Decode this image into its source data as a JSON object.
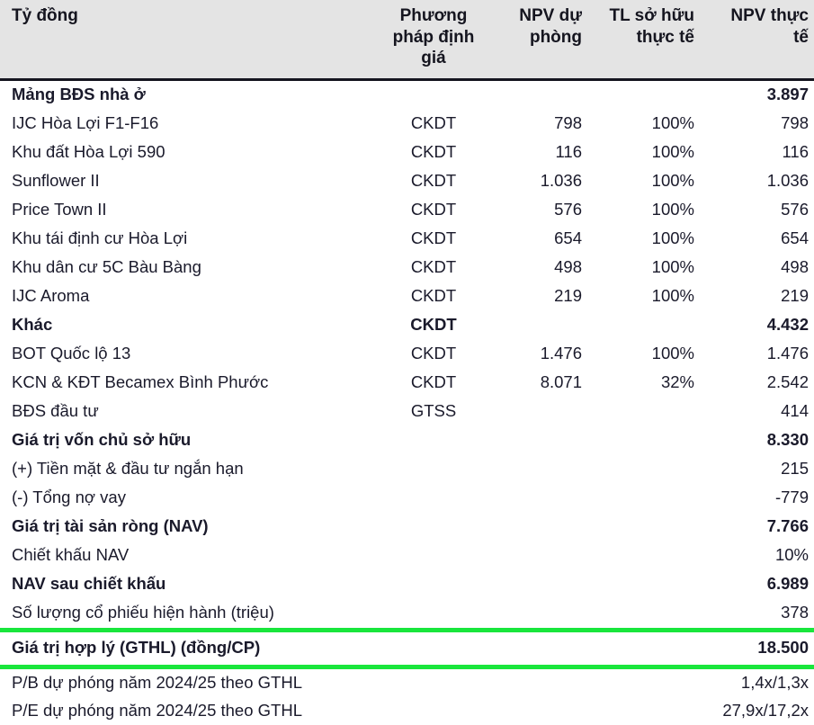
{
  "table": {
    "columns": [
      {
        "key": "label",
        "header": "Tỷ đồng",
        "align": "left"
      },
      {
        "key": "method",
        "header": "Phương pháp định giá",
        "align": "center"
      },
      {
        "key": "npv",
        "header": "NPV dự phòng",
        "align": "right"
      },
      {
        "key": "own",
        "header": "TL sở hữu thực tế",
        "align": "right"
      },
      {
        "key": "actual",
        "header": "NPV thực tế",
        "align": "right"
      }
    ],
    "header": {
      "label": "Tỷ đồng",
      "method_line1": "Phương",
      "method_line2": "pháp định",
      "method_line3": "giá",
      "npv_line1": "NPV dự",
      "npv_line2": "phòng",
      "own_line1": "TL sở hữu",
      "own_line2": "thực tế",
      "actual_line1": "NPV thực",
      "actual_line2": "tế"
    },
    "rows": [
      {
        "label": "Mảng BĐS nhà ở",
        "method": "",
        "npv": "",
        "own": "",
        "actual": "3.897",
        "style": "bold"
      },
      {
        "label": "IJC Hòa Lợi F1-F16",
        "method": "CKDT",
        "npv": "798",
        "own": "100%",
        "actual": "798",
        "style": "normal"
      },
      {
        "label": "Khu đất Hòa Lợi 590",
        "method": "CKDT",
        "npv": "116",
        "own": "100%",
        "actual": "116",
        "style": "normal"
      },
      {
        "label": "Sunflower II",
        "method": "CKDT",
        "npv": "1.036",
        "own": "100%",
        "actual": "1.036",
        "style": "normal"
      },
      {
        "label": "Price Town II",
        "method": "CKDT",
        "npv": "576",
        "own": "100%",
        "actual": "576",
        "style": "normal"
      },
      {
        "label": "Khu tái định cư Hòa Lợi",
        "method": "CKDT",
        "npv": "654",
        "own": "100%",
        "actual": "654",
        "style": "normal"
      },
      {
        "label": "Khu dân cư 5C Bàu Bàng",
        "method": "CKDT",
        "npv": "498",
        "own": "100%",
        "actual": "498",
        "style": "normal"
      },
      {
        "label": "IJC Aroma",
        "method": "CKDT",
        "npv": "219",
        "own": "100%",
        "actual": "219",
        "style": "normal"
      },
      {
        "label": "Khác",
        "method": "CKDT",
        "npv": "",
        "own": "",
        "actual": "4.432",
        "style": "bold"
      },
      {
        "label": "BOT Quốc lộ 13",
        "method": "CKDT",
        "npv": "1.476",
        "own": "100%",
        "actual": "1.476",
        "style": "normal"
      },
      {
        "label": "KCN & KĐT Becamex Bình Phước",
        "method": "CKDT",
        "npv": "8.071",
        "own": "32%",
        "actual": "2.542",
        "style": "normal"
      },
      {
        "label": "BĐS đầu tư",
        "method": "GTSS",
        "npv": "",
        "own": "",
        "actual": "414",
        "style": "normal"
      },
      {
        "label": "Giá trị vốn chủ sở hữu",
        "method": "",
        "npv": "",
        "own": "",
        "actual": "8.330",
        "style": "bold"
      },
      {
        "label": "(+) Tiền mặt & đầu tư ngắn hạn",
        "method": "",
        "npv": "",
        "own": "",
        "actual": "215",
        "style": "normal"
      },
      {
        "label": "(-) Tổng nợ vay",
        "method": "",
        "npv": "",
        "own": "",
        "actual": "-779",
        "style": "normal"
      },
      {
        "label": "Giá trị tài sản ròng (NAV)",
        "method": "",
        "npv": "",
        "own": "",
        "actual": "7.766",
        "style": "bold"
      },
      {
        "label": "Chiết khấu NAV",
        "method": "",
        "npv": "",
        "own": "",
        "actual": "10%",
        "style": "normal"
      },
      {
        "label": "NAV sau chiết khấu",
        "method": "",
        "npv": "",
        "own": "",
        "actual": "6.989",
        "style": "bold"
      },
      {
        "label": "Số lượng cổ phiếu hiện hành (triệu)",
        "method": "",
        "npv": "",
        "own": "",
        "actual": "378",
        "style": "normal"
      },
      {
        "label": "Giá trị hợp lý (GTHL) (đồng/CP)",
        "method": "",
        "npv": "",
        "own": "",
        "actual": "18.500",
        "style": "highlight"
      },
      {
        "label": "P/B dự phóng năm 2024/25 theo GTHL",
        "method": "",
        "npv": "",
        "own": "",
        "actual": "1,4x/1,3x",
        "style": "ratio"
      },
      {
        "label": "P/E dự phóng năm 2024/25 theo GTHL",
        "method": "",
        "npv": "",
        "own": "",
        "actual": "27,9x/17,2x",
        "style": "ratio"
      }
    ]
  },
  "colors": {
    "header_background": "#e4e4e4",
    "header_rule": "#15151f",
    "highlight_green": "#19e63c",
    "text": "#1a1a2b",
    "page_background": "#ffffff"
  }
}
